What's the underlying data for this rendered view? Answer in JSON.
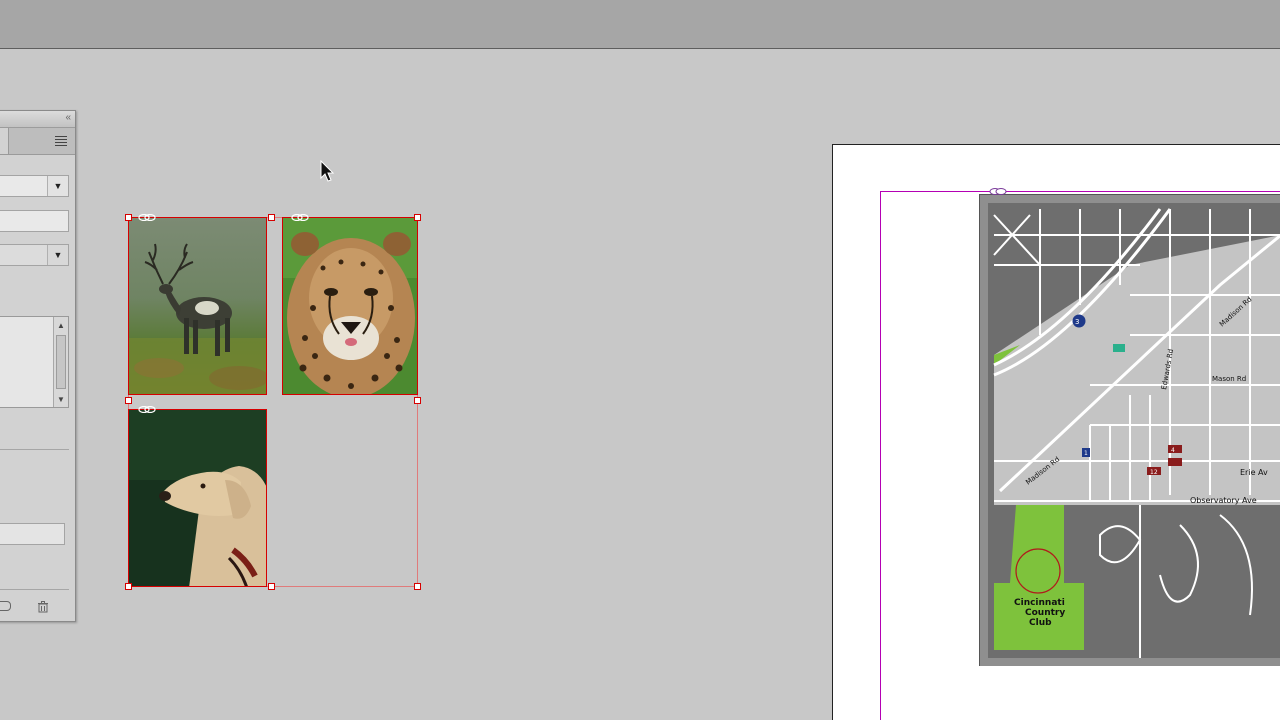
{
  "app": {
    "toolbar": "",
    "panel": {
      "collapse_glyph": "«",
      "menu_icon": "panel-menu-icon",
      "delete_icon": "trash-icon"
    }
  },
  "map": {
    "labels": {
      "country_club": [
        "Cincinnati",
        "Country",
        "Club"
      ],
      "edwards_rd": "Edwards Rd",
      "madison_rd_upper": "Madison Rd",
      "madison_rd_lower": "Madison Rd",
      "observatory_ave": "Observatory Ave",
      "erie_ave": "Erie Av",
      "mason_rd": "Mason Rd",
      "shields": [
        "3",
        "12",
        "4",
        "1"
      ]
    }
  },
  "colors": {
    "selection": "#d60000",
    "margin": "#b400b4",
    "map_gray": "#6e6e6e",
    "map_light": "#c4c4c4",
    "map_green": "#7ec23c"
  }
}
